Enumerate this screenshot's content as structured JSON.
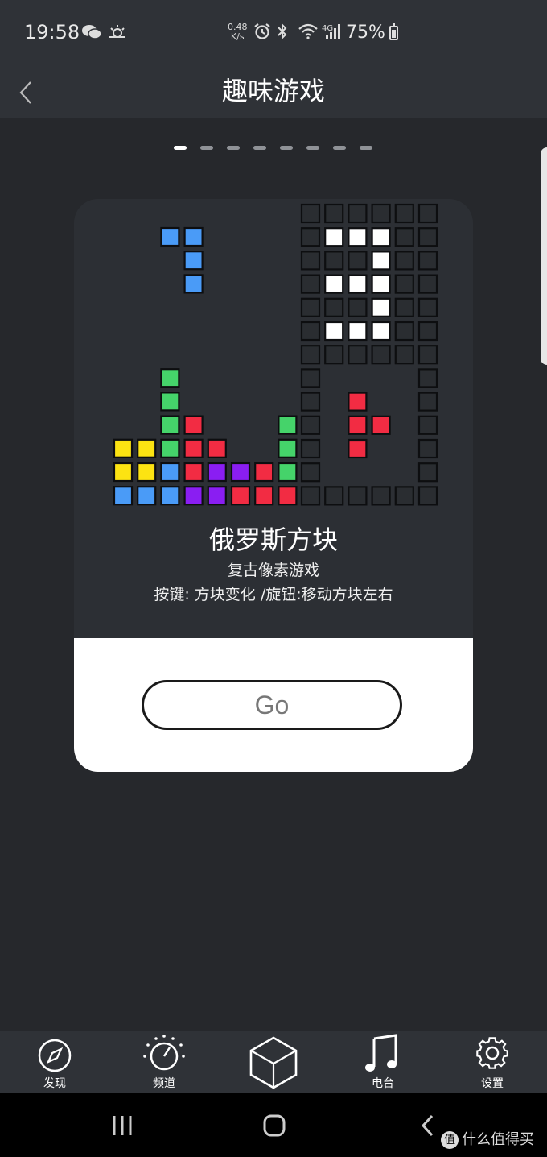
{
  "status_bar": {
    "time": "19:58",
    "speed_value": "0.48",
    "speed_unit": "K/s",
    "network": "4G",
    "battery": "75%",
    "icons": [
      "wechat-icon",
      "weather-icon",
      "alarm-icon",
      "bluetooth-icon",
      "wifi-icon",
      "signal-icon",
      "battery-icon"
    ]
  },
  "header": {
    "title": "趣味游戏",
    "back_icon": "chevron-left-icon"
  },
  "pager": {
    "count": 8,
    "active_index": 0
  },
  "card": {
    "game_title": "俄罗斯方块",
    "subtitle": "复古像素游戏",
    "hint": "按键: 方块变化 /旋钮:移动方块左右",
    "go_label": "Go"
  },
  "bottom_nav": {
    "items": [
      {
        "label": "发现",
        "icon": "compass-icon"
      },
      {
        "label": "频道",
        "icon": "dial-icon"
      },
      {
        "label": "",
        "icon": "cube-icon"
      },
      {
        "label": "电台",
        "icon": "music-note-icon"
      },
      {
        "label": "设置",
        "icon": "gear-icon"
      }
    ]
  },
  "system_nav": {
    "icons": [
      "recent-apps-icon",
      "home-icon",
      "back-icon"
    ]
  },
  "watermark": {
    "badge": "值",
    "text": "什么值得买"
  },
  "colors": {
    "background": "#26282c",
    "bar": "#2f3237",
    "card_dark": "#2c2f34",
    "tetris_blue": "#4a9bf7",
    "tetris_green": "#45d36a",
    "tetris_red": "#f22c43",
    "tetris_yellow": "#fce312",
    "tetris_purple": "#8a1ef2",
    "grid_cell": "#2a2d31"
  }
}
